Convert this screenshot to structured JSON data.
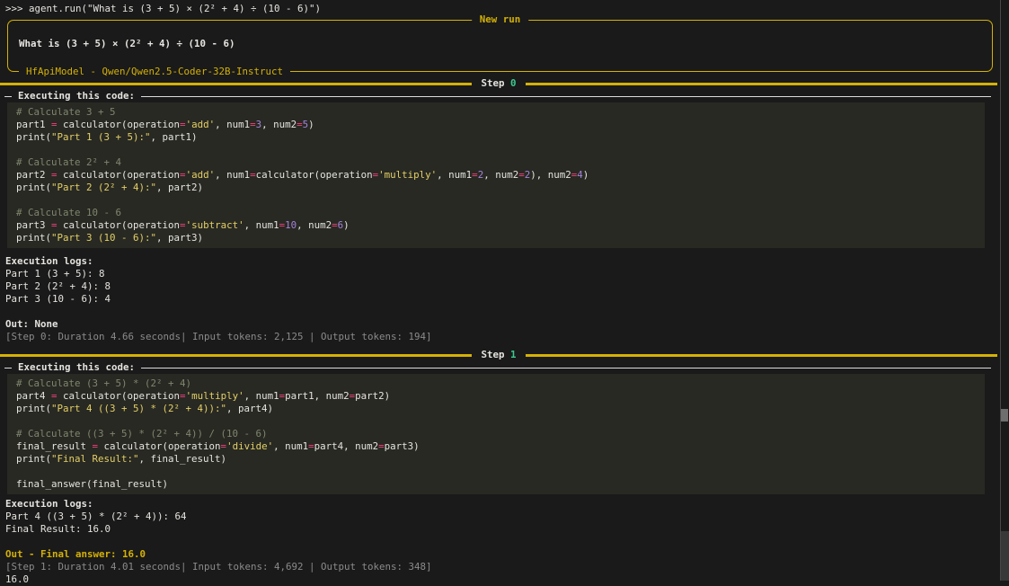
{
  "repl": {
    "input_line": ">>> agent.run(\"What is (3 + 5) × (2² + 4) ÷ (10 - 6)\")",
    "final_output": "16.0"
  },
  "new_run_panel": {
    "title": "New run",
    "task": "What is (3 + 5) × (2² + 4) ÷ (10 - 6)",
    "subtitle": "HfApiModel - Qwen/Qwen2.5-Coder-32B-Instruct"
  },
  "colors": {
    "accent_yellow": "#d4b106",
    "step_number_green": "#3cc98e",
    "operator_pink": "#f0427c",
    "number_purple": "#a583da",
    "string_yellow": "#e4cf66",
    "comment_olive": "#7f866e",
    "code_background": "#282923",
    "page_background": "#1a1a1a",
    "dim_gray": "#8b8b8b"
  },
  "steps": [
    {
      "rule_prefix": "Step ",
      "rule_number": "0",
      "code_header": "Executing this code:",
      "code_lines": [
        [
          [
            "cm",
            "# Calculate 3 + 5"
          ]
        ],
        [
          [
            "id",
            "part1 "
          ],
          [
            "op",
            "="
          ],
          [
            "id",
            " calculator(operation"
          ],
          [
            "op",
            "="
          ],
          [
            "st",
            "'add'"
          ],
          [
            "id",
            ", num1"
          ],
          [
            "op",
            "="
          ],
          [
            "nu",
            "3"
          ],
          [
            "id",
            ", num2"
          ],
          [
            "op",
            "="
          ],
          [
            "nu",
            "5"
          ],
          [
            "id",
            ")"
          ]
        ],
        [
          [
            "id",
            "print("
          ],
          [
            "st",
            "\"Part 1 (3 + 5):\""
          ],
          [
            "id",
            ", part1)"
          ]
        ],
        [],
        [
          [
            "cm",
            "# Calculate 2² + 4"
          ]
        ],
        [
          [
            "id",
            "part2 "
          ],
          [
            "op",
            "="
          ],
          [
            "id",
            " calculator(operation"
          ],
          [
            "op",
            "="
          ],
          [
            "st",
            "'add'"
          ],
          [
            "id",
            ", num1"
          ],
          [
            "op",
            "="
          ],
          [
            "id",
            "calculator(operation"
          ],
          [
            "op",
            "="
          ],
          [
            "st",
            "'multiply'"
          ],
          [
            "id",
            ", num1"
          ],
          [
            "op",
            "="
          ],
          [
            "nu",
            "2"
          ],
          [
            "id",
            ", num2"
          ],
          [
            "op",
            "="
          ],
          [
            "nu",
            "2"
          ],
          [
            "id",
            "), num2"
          ],
          [
            "op",
            "="
          ],
          [
            "nu",
            "4"
          ],
          [
            "id",
            ")"
          ]
        ],
        [
          [
            "id",
            "print("
          ],
          [
            "st",
            "\"Part 2 (2² + 4):\""
          ],
          [
            "id",
            ", part2)"
          ]
        ],
        [],
        [
          [
            "cm",
            "# Calculate 10 - 6"
          ]
        ],
        [
          [
            "id",
            "part3 "
          ],
          [
            "op",
            "="
          ],
          [
            "id",
            " calculator(operation"
          ],
          [
            "op",
            "="
          ],
          [
            "st",
            "'subtract'"
          ],
          [
            "id",
            ", num1"
          ],
          [
            "op",
            "="
          ],
          [
            "nu",
            "10"
          ],
          [
            "id",
            ", num2"
          ],
          [
            "op",
            "="
          ],
          [
            "nu",
            "6"
          ],
          [
            "id",
            ")"
          ]
        ],
        [
          [
            "id",
            "print("
          ],
          [
            "st",
            "\"Part 3 (10 - 6):\""
          ],
          [
            "id",
            ", part3)"
          ]
        ]
      ],
      "logs_header": "Execution logs:",
      "log_lines": [
        "Part 1 (3 + 5): 8",
        "Part 2 (2² + 4): 8",
        "Part 3 (10 - 6): 4"
      ],
      "out_label": "Out:",
      "out_value": " None",
      "footer": "[Step 0: Duration 4.66 seconds| Input tokens: 2,125 | Output tokens: 194]"
    },
    {
      "rule_prefix": "Step ",
      "rule_number": "1",
      "code_header": "Executing this code:",
      "code_lines": [
        [
          [
            "cm",
            "# Calculate (3 + 5) * (2² + 4)"
          ]
        ],
        [
          [
            "id",
            "part4 "
          ],
          [
            "op",
            "="
          ],
          [
            "id",
            " calculator(operation"
          ],
          [
            "op",
            "="
          ],
          [
            "st",
            "'multiply'"
          ],
          [
            "id",
            ", num1"
          ],
          [
            "op",
            "="
          ],
          [
            "id",
            "part1, num2"
          ],
          [
            "op",
            "="
          ],
          [
            "id",
            "part2)"
          ]
        ],
        [
          [
            "id",
            "print("
          ],
          [
            "st",
            "\"Part 4 ((3 + 5) * (2² + 4)):\""
          ],
          [
            "id",
            ", part4)"
          ]
        ],
        [],
        [
          [
            "cm",
            "# Calculate ((3 + 5) * (2² + 4)) / (10 - 6)"
          ]
        ],
        [
          [
            "id",
            "final_result "
          ],
          [
            "op",
            "="
          ],
          [
            "id",
            " calculator(operation"
          ],
          [
            "op",
            "="
          ],
          [
            "st",
            "'divide'"
          ],
          [
            "id",
            ", num1"
          ],
          [
            "op",
            "="
          ],
          [
            "id",
            "part4, num2"
          ],
          [
            "op",
            "="
          ],
          [
            "id",
            "part3)"
          ]
        ],
        [
          [
            "id",
            "print("
          ],
          [
            "st",
            "\"Final Result:\""
          ],
          [
            "id",
            ", final_result)"
          ]
        ],
        [],
        [
          [
            "id",
            "final_answer(final_result)"
          ]
        ]
      ],
      "logs_header": "Execution logs:",
      "log_lines": [
        "Part 4 ((3 + 5) * (2² + 4)): 64",
        "Final Result: 16.0"
      ],
      "out_final": "Out - Final answer: 16.0",
      "footer": "[Step 1: Duration 4.01 seconds| Input tokens: 4,692 | Output tokens: 348]"
    }
  ]
}
